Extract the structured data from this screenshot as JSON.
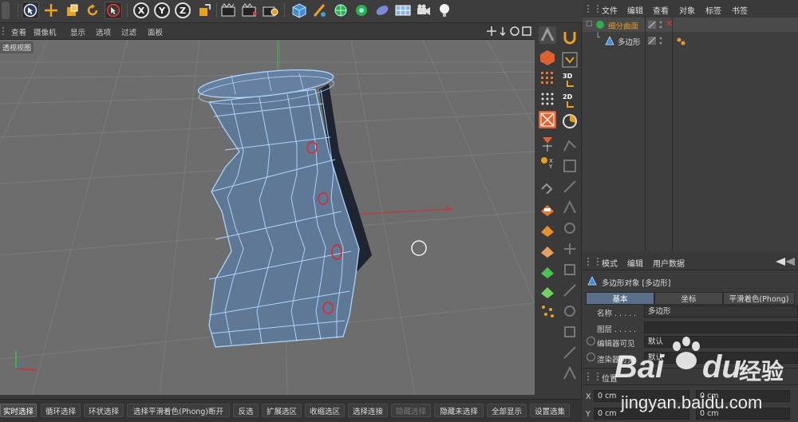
{
  "toolbar": {
    "x_label": "X",
    "y_label": "Y",
    "z_label": "Z"
  },
  "viewport_menu": {
    "items": [
      "查看",
      "摄像机",
      "显示",
      "选项",
      "过滤",
      "面板"
    ],
    "label": "透视视图"
  },
  "object_manager": {
    "menu": [
      "文件",
      "编辑",
      "查看",
      "对象",
      "标签",
      "书签"
    ],
    "objects": [
      {
        "name": "细分曲面",
        "color": "#e39a2b"
      },
      {
        "name": "多边形",
        "color": "#e39a2b"
      }
    ]
  },
  "attributes": {
    "menu": [
      "模式",
      "编辑",
      "用户数据"
    ],
    "object_title": "多边形对象 [多边形]",
    "tabs": [
      "基本",
      "坐标",
      "平滑着色(Phong)"
    ],
    "active_tab": "基本",
    "props": [
      {
        "label": "名称 . . . . .",
        "value": "多边形"
      },
      {
        "label": "图层 . . . . .",
        "value": ""
      },
      {
        "label": "编辑器可见",
        "value": "默认"
      },
      {
        "label": "渲染器可见",
        "value": "默认"
      }
    ],
    "coords_header": "位置",
    "coords": [
      {
        "axis": "X",
        "val1": "0 cm",
        "val2": "0 cm"
      },
      {
        "axis": "Y",
        "val1": "0 cm",
        "val2": "0 cm"
      }
    ]
  },
  "bottom_bar": {
    "buttons": [
      {
        "label": "实时选择",
        "state": "active"
      },
      {
        "label": "循环选择",
        "state": "normal"
      },
      {
        "label": "环状选择",
        "state": "normal"
      },
      {
        "label": "选择平滑着色(Phong)断开",
        "state": "normal"
      },
      {
        "label": "反选",
        "state": "normal"
      },
      {
        "label": "扩展选区",
        "state": "normal"
      },
      {
        "label": "收缩选区",
        "state": "normal"
      },
      {
        "label": "选择连接",
        "state": "normal"
      },
      {
        "label": "隐藏选择",
        "state": "disabled"
      },
      {
        "label": "隐藏未选择",
        "state": "normal"
      },
      {
        "label": "全部显示",
        "state": "normal"
      },
      {
        "label": "设置选集",
        "state": "normal"
      }
    ]
  },
  "watermark": {
    "brand": "Bai",
    "brand2": "du",
    "cn": "经验",
    "url": "jingyan.baidu.com"
  },
  "colors": {
    "mesh_fill": "#5d7692",
    "mesh_edge": "#9fd0ff",
    "annotation": "#e32626",
    "accent_orange": "#e39a2b"
  }
}
